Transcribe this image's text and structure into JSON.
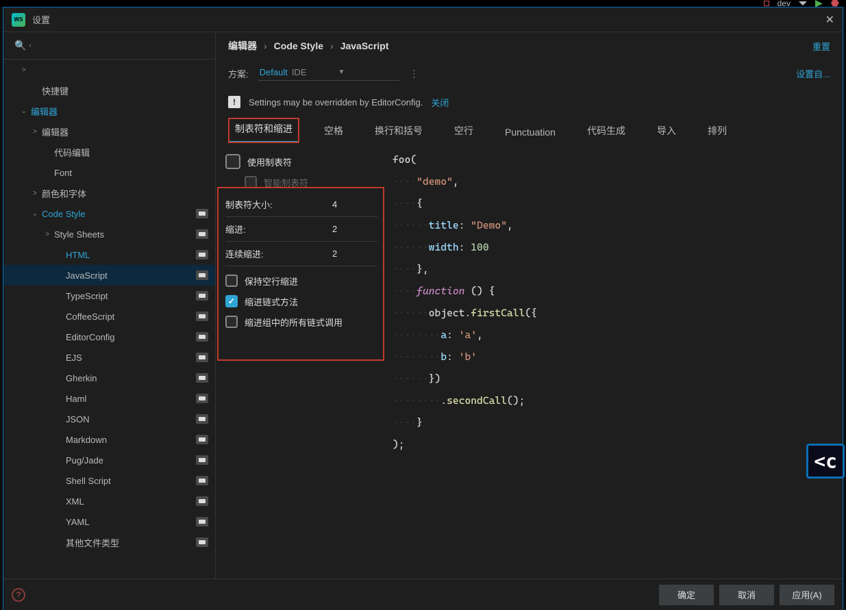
{
  "top_indicator": {
    "dev_label": "dev"
  },
  "titlebar": {
    "app_logo_text": "WS",
    "title": "设置"
  },
  "crumbs": {
    "seg1": "编辑器",
    "seg2": "Code Style",
    "seg3": "JavaScript",
    "reset": "重置"
  },
  "scheme": {
    "label": "方案:",
    "value_default": "Default",
    "value_ide": "IDE",
    "set_from": "设置自..."
  },
  "notice": {
    "warn": "!",
    "msg": "Settings may be overridden by EditorConfig.",
    "close": "关闭"
  },
  "tabs": {
    "tabs_indents": "制表符和缩进",
    "spaces": "空格",
    "wrapping": "换行和括号",
    "blank": "空行",
    "punctuation": "Punctuation",
    "codegen": "代码生成",
    "imports": "导入",
    "arrangement": "排列"
  },
  "form": {
    "use_tab": "使用制表符",
    "smart_tabs": "智能制表符",
    "tab_size_label": "制表符大小:",
    "tab_size_val": "4",
    "indent_label": "缩进:",
    "indent_val": "2",
    "cont_indent_label": "连续缩进:",
    "cont_indent_val": "2",
    "keep_blank": "保持空行缩进",
    "chain_indent": "缩进链式方法",
    "chain_group": "缩进组中的所有链式调用"
  },
  "sidebar": {
    "items": [
      {
        "txt": "",
        "indent": 24,
        "chev": ">",
        "badge": false
      },
      {
        "txt": "快捷键",
        "indent": 40,
        "chev": "",
        "badge": false
      },
      {
        "txt": "编辑器",
        "indent": 24,
        "chev": "⌄",
        "badge": false,
        "active": true
      },
      {
        "txt": "编辑器",
        "indent": 40,
        "chev": ">",
        "badge": false
      },
      {
        "txt": "代码编辑",
        "indent": 58,
        "chev": "",
        "badge": false
      },
      {
        "txt": "Font",
        "indent": 58,
        "chev": "",
        "badge": false
      },
      {
        "txt": "颜色和字体",
        "indent": 40,
        "chev": ">",
        "badge": false
      },
      {
        "txt": "Code Style",
        "indent": 40,
        "chev": "⌄",
        "badge": true,
        "active": true
      },
      {
        "txt": "Style Sheets",
        "indent": 58,
        "chev": ">",
        "badge": true
      },
      {
        "txt": "HTML",
        "indent": 75,
        "chev": "",
        "badge": true,
        "active": true
      },
      {
        "txt": "JavaScript",
        "indent": 75,
        "chev": "",
        "badge": true,
        "selected": true
      },
      {
        "txt": "TypeScript",
        "indent": 75,
        "chev": "",
        "badge": true
      },
      {
        "txt": "CoffeeScript",
        "indent": 75,
        "chev": "",
        "badge": true
      },
      {
        "txt": "EditorConfig",
        "indent": 75,
        "chev": "",
        "badge": true
      },
      {
        "txt": "EJS",
        "indent": 75,
        "chev": "",
        "badge": true
      },
      {
        "txt": "Gherkin",
        "indent": 75,
        "chev": "",
        "badge": true
      },
      {
        "txt": "Haml",
        "indent": 75,
        "chev": "",
        "badge": true
      },
      {
        "txt": "JSON",
        "indent": 75,
        "chev": "",
        "badge": true
      },
      {
        "txt": "Markdown",
        "indent": 75,
        "chev": "",
        "badge": true
      },
      {
        "txt": "Pug/Jade",
        "indent": 75,
        "chev": "",
        "badge": true
      },
      {
        "txt": "Shell Script",
        "indent": 75,
        "chev": "",
        "badge": true
      },
      {
        "txt": "XML",
        "indent": 75,
        "chev": "",
        "badge": true
      },
      {
        "txt": "YAML",
        "indent": 75,
        "chev": "",
        "badge": true
      },
      {
        "txt": "其他文件类型",
        "indent": 75,
        "chev": "",
        "badge": true
      }
    ]
  },
  "footer": {
    "help": "?",
    "ok": "确定",
    "cancel": "取消",
    "apply": "应用(A)"
  },
  "preview": {
    "lines": [
      [
        {
          "c": "id",
          "t": "foo"
        },
        {
          "c": "pun",
          "t": "("
        }
      ],
      [
        {
          "c": "dot",
          "t": "····"
        },
        {
          "c": "str",
          "t": "\"demo\""
        },
        {
          "c": "pun",
          "t": ","
        }
      ],
      [
        {
          "c": "dot",
          "t": "····"
        },
        {
          "c": "pun",
          "t": "{"
        }
      ],
      [
        {
          "c": "dot",
          "t": "······"
        },
        {
          "c": "key",
          "t": "title"
        },
        {
          "c": "pun",
          "t": ": "
        },
        {
          "c": "str",
          "t": "\"Demo\""
        },
        {
          "c": "pun",
          "t": ","
        }
      ],
      [
        {
          "c": "dot",
          "t": "······"
        },
        {
          "c": "key",
          "t": "width"
        },
        {
          "c": "pun",
          "t": ": "
        },
        {
          "c": "num",
          "t": "100"
        }
      ],
      [
        {
          "c": "dot",
          "t": "····"
        },
        {
          "c": "pun",
          "t": "},"
        }
      ],
      [
        {
          "c": "dot",
          "t": "····"
        },
        {
          "c": "kw",
          "t": "function"
        },
        {
          "c": "pun",
          "t": " () {"
        }
      ],
      [
        {
          "c": "dot",
          "t": "······"
        },
        {
          "c": "id",
          "t": "object"
        },
        {
          "c": "pun",
          "t": "."
        },
        {
          "c": "call",
          "t": "firstCall"
        },
        {
          "c": "pun",
          "t": "({"
        }
      ],
      [
        {
          "c": "dot",
          "t": "········"
        },
        {
          "c": "key",
          "t": "a"
        },
        {
          "c": "pun",
          "t": ": "
        },
        {
          "c": "str",
          "t": "'a'"
        },
        {
          "c": "pun",
          "t": ","
        }
      ],
      [
        {
          "c": "dot",
          "t": "········"
        },
        {
          "c": "key",
          "t": "b"
        },
        {
          "c": "pun",
          "t": ": "
        },
        {
          "c": "str",
          "t": "'b'"
        }
      ],
      [
        {
          "c": "dot",
          "t": "······"
        },
        {
          "c": "pun",
          "t": "})"
        }
      ],
      [
        {
          "c": "dot",
          "t": "········"
        },
        {
          "c": "pun",
          "t": "."
        },
        {
          "c": "call",
          "t": "secondCall"
        },
        {
          "c": "pun",
          "t": "();"
        }
      ],
      [
        {
          "c": "dot",
          "t": "····"
        },
        {
          "c": "pun",
          "t": "}"
        }
      ],
      [
        {
          "c": "pun",
          "t": ");"
        }
      ]
    ]
  },
  "floating": "<c"
}
